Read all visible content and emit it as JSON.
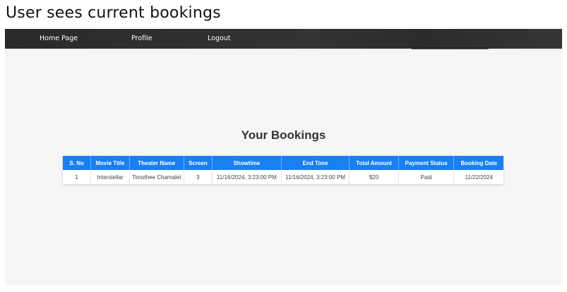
{
  "caption": "User sees current bookings",
  "nav": {
    "home_label": "Home Page",
    "profile_label": "Profile",
    "logout_label": "Logout"
  },
  "main": {
    "title": "Your Bookings"
  },
  "table": {
    "headers": {
      "sno": "S. No",
      "movie_title": "Movie Title",
      "theater_name": "Theater Name",
      "screen": "Screen",
      "showtime": "Showtime",
      "end_time": "End Time",
      "total_amount": "Total Amount",
      "payment_status": "Payment Status",
      "booking_date": "Booking Date"
    },
    "rows": [
      {
        "sno": "1",
        "movie_title": "Interstellar",
        "theater_name": "Timothee Chamalet",
        "screen": "3",
        "showtime": "11/16/2024, 3:23:00 PM",
        "end_time": "11/16/2024, 3:23:00 PM",
        "total_amount": "$20",
        "payment_status": "Paid",
        "booking_date": "11/22/2024"
      }
    ]
  },
  "colors": {
    "navbar": "#2f2f2f",
    "table_header": "#1a7ff0",
    "page_background": "#f5f6f8"
  }
}
